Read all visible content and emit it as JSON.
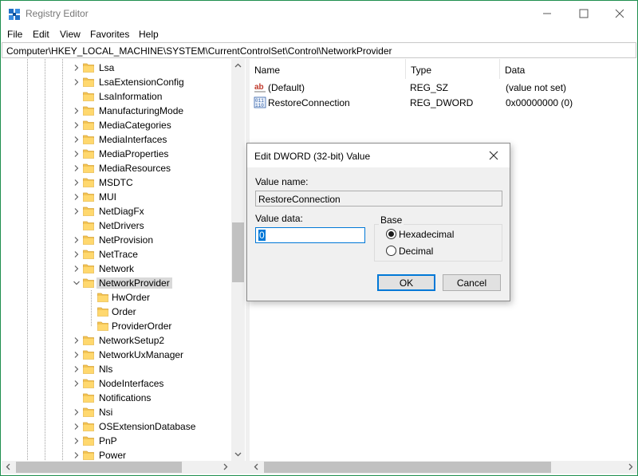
{
  "window": {
    "title": "Registry Editor"
  },
  "menu": [
    "File",
    "Edit",
    "View",
    "Favorites",
    "Help"
  ],
  "address": "Computer\\HKEY_LOCAL_MACHINE\\SYSTEM\\CurrentControlSet\\Control\\NetworkProvider",
  "tree": {
    "items": [
      {
        "label": "Lsa",
        "expandable": true
      },
      {
        "label": "LsaExtensionConfig",
        "expandable": true
      },
      {
        "label": "LsaInformation",
        "expandable": false
      },
      {
        "label": "ManufacturingMode",
        "expandable": true
      },
      {
        "label": "MediaCategories",
        "expandable": true
      },
      {
        "label": "MediaInterfaces",
        "expandable": true
      },
      {
        "label": "MediaProperties",
        "expandable": true
      },
      {
        "label": "MediaResources",
        "expandable": true
      },
      {
        "label": "MSDTC",
        "expandable": true
      },
      {
        "label": "MUI",
        "expandable": true
      },
      {
        "label": "NetDiagFx",
        "expandable": true
      },
      {
        "label": "NetDrivers",
        "expandable": false
      },
      {
        "label": "NetProvision",
        "expandable": true
      },
      {
        "label": "NetTrace",
        "expandable": true
      },
      {
        "label": "Network",
        "expandable": true
      },
      {
        "label": "NetworkProvider",
        "expandable": true,
        "expanded": true,
        "selected": true
      },
      {
        "label": "HwOrder",
        "child": true
      },
      {
        "label": "Order",
        "child": true
      },
      {
        "label": "ProviderOrder",
        "child": true
      },
      {
        "label": "NetworkSetup2",
        "expandable": true
      },
      {
        "label": "NetworkUxManager",
        "expandable": true
      },
      {
        "label": "Nls",
        "expandable": true
      },
      {
        "label": "NodeInterfaces",
        "expandable": true
      },
      {
        "label": "Notifications",
        "expandable": false
      },
      {
        "label": "Nsi",
        "expandable": true
      },
      {
        "label": "OSExtensionDatabase",
        "expandable": true
      },
      {
        "label": "PnP",
        "expandable": true
      },
      {
        "label": "Power",
        "expandable": true
      }
    ]
  },
  "list": {
    "columns": [
      "Name",
      "Type",
      "Data"
    ],
    "rows": [
      {
        "name": "(Default)",
        "type": "REG_SZ",
        "data": "(value not set)",
        "icon": "string-value-icon"
      },
      {
        "name": "RestoreConnection",
        "type": "REG_DWORD",
        "data": "0x00000000 (0)",
        "icon": "binary-value-icon"
      }
    ]
  },
  "dialog": {
    "title": "Edit DWORD (32-bit) Value",
    "value_name_label": "Value name:",
    "value_name": "RestoreConnection",
    "value_data_label": "Value data:",
    "value_data": "0",
    "base_label": "Base",
    "hex_label": "Hexadecimal",
    "dec_label": "Decimal",
    "selected_base": "hexadecimal",
    "ok_label": "OK",
    "cancel_label": "Cancel"
  }
}
